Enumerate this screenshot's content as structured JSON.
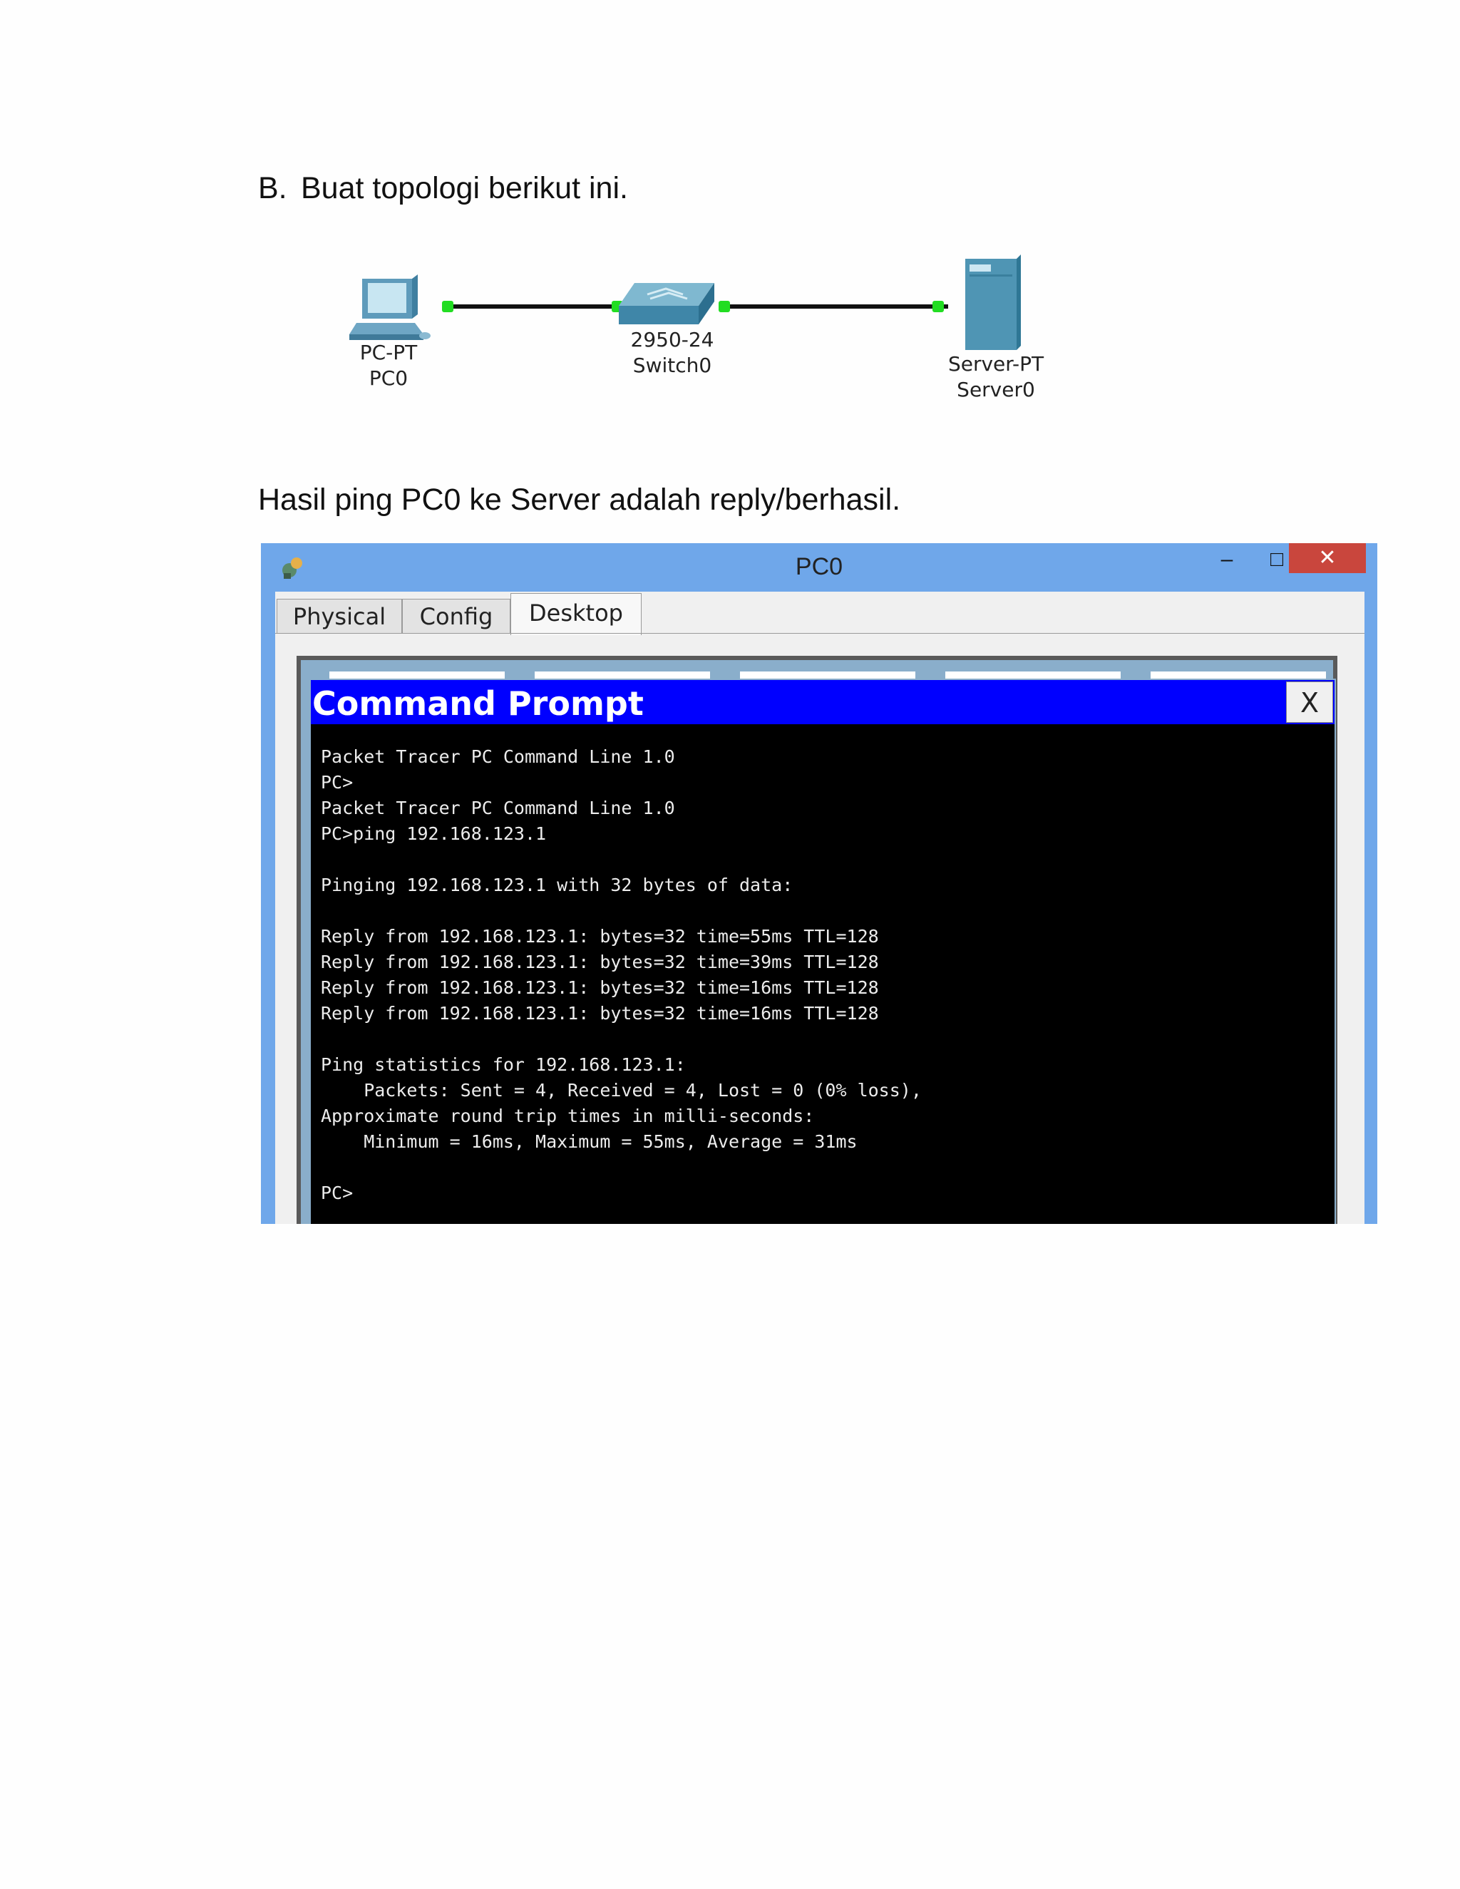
{
  "section": {
    "marker": "B.",
    "heading": "Buat topologi berikut ini."
  },
  "topology": {
    "devices": [
      {
        "type": "PC-PT",
        "name": "PC0",
        "icon": "pc-icon"
      },
      {
        "type": "2950-24",
        "name": "Switch0",
        "icon": "switch-icon"
      },
      {
        "type": "Server-PT",
        "name": "Server0",
        "icon": "server-icon"
      }
    ],
    "link_color": "#111111",
    "port_status_color": "#22dd22"
  },
  "result_text": "Hasil ping PC0 ke Server adalah reply/berhasil.",
  "window": {
    "title": "PC0",
    "controls": {
      "minimize": "–",
      "maximize": "□",
      "close": "✕"
    },
    "tabs": [
      {
        "label": "Physical",
        "active": false
      },
      {
        "label": "Config",
        "active": false
      },
      {
        "label": "Desktop",
        "active": true
      }
    ],
    "command_prompt": {
      "title": "Command Prompt",
      "close_label": "X",
      "output": "Packet Tracer PC Command Line 1.0\nPC>\nPacket Tracer PC Command Line 1.0\nPC>ping 192.168.123.1\n\nPinging 192.168.123.1 with 32 bytes of data:\n\nReply from 192.168.123.1: bytes=32 time=55ms TTL=128\nReply from 192.168.123.1: bytes=32 time=39ms TTL=128\nReply from 192.168.123.1: bytes=32 time=16ms TTL=128\nReply from 192.168.123.1: bytes=32 time=16ms TTL=128\n\nPing statistics for 192.168.123.1:\n    Packets: Sent = 4, Received = 4, Lost = 0 (0% loss),\nApproximate round trip times in milli-seconds:\n    Minimum = 16ms, Maximum = 55ms, Average = 31ms\n\nPC>"
    },
    "colors": {
      "titlebar": "#6fa7ea",
      "close_button": "#c9463d",
      "prompt_titlebar": "#0000ff",
      "prompt_background": "#000000"
    }
  }
}
